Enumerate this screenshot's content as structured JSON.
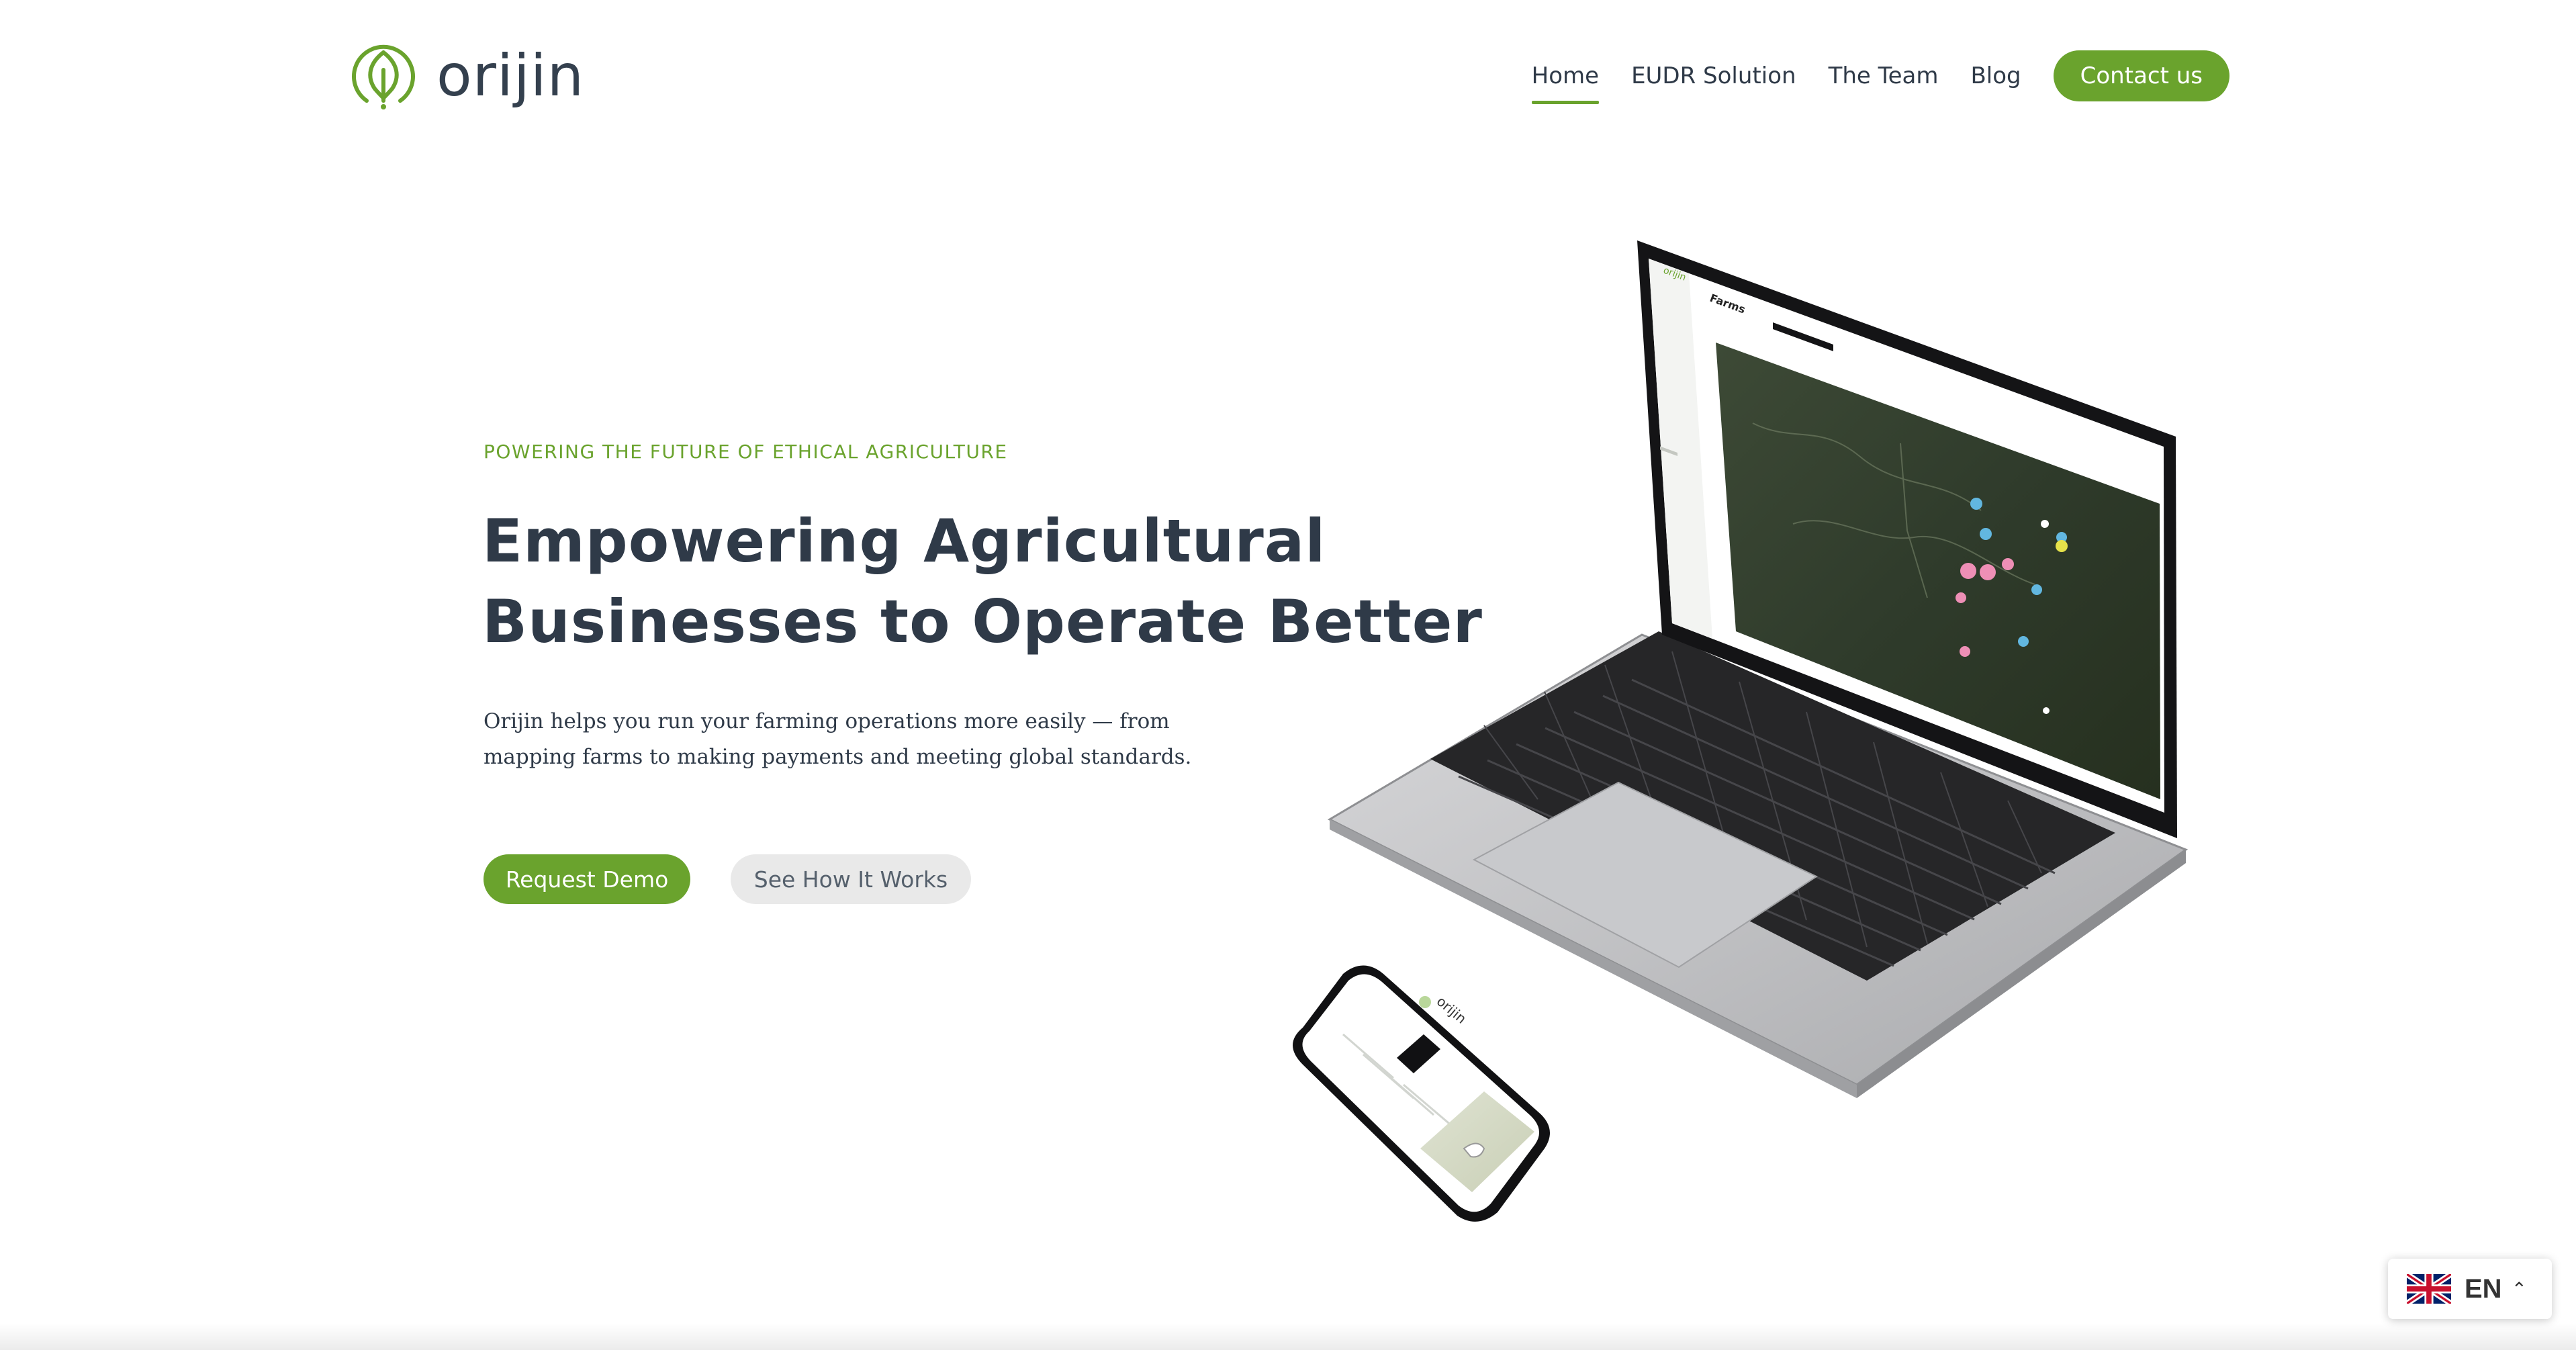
{
  "brand": {
    "name": "orijin",
    "accent": "#6aa32d",
    "text_color": "#2f3a48",
    "logo_icon": "leaf-in-circle-icon"
  },
  "nav": {
    "items": [
      {
        "label": "Home",
        "active": true
      },
      {
        "label": "EUDR Solution",
        "active": false
      },
      {
        "label": "The Team",
        "active": false
      },
      {
        "label": "Blog",
        "active": false
      }
    ],
    "cta": "Contact us"
  },
  "hero": {
    "eyebrow": "POWERING THE FUTURE OF ETHICAL AGRICULTURE",
    "headline_lines": [
      "Empowering Agricultural",
      "Businesses to Operate Better"
    ],
    "lede_lines": [
      "Orijin helps you run your farming operations more easily — from",
      "mapping farms to making payments and meeting global standards."
    ],
    "primary_button": "Request Demo",
    "secondary_button": "See How It Works"
  },
  "illustration": {
    "laptop_screen": {
      "app_name": "orijin",
      "page_title": "Farms"
    },
    "phone_screen": {
      "app_name": "orijin"
    }
  },
  "language": {
    "code": "EN",
    "flag_icon": "uk-flag-icon",
    "chevron_icon": "chevron-up-icon"
  }
}
